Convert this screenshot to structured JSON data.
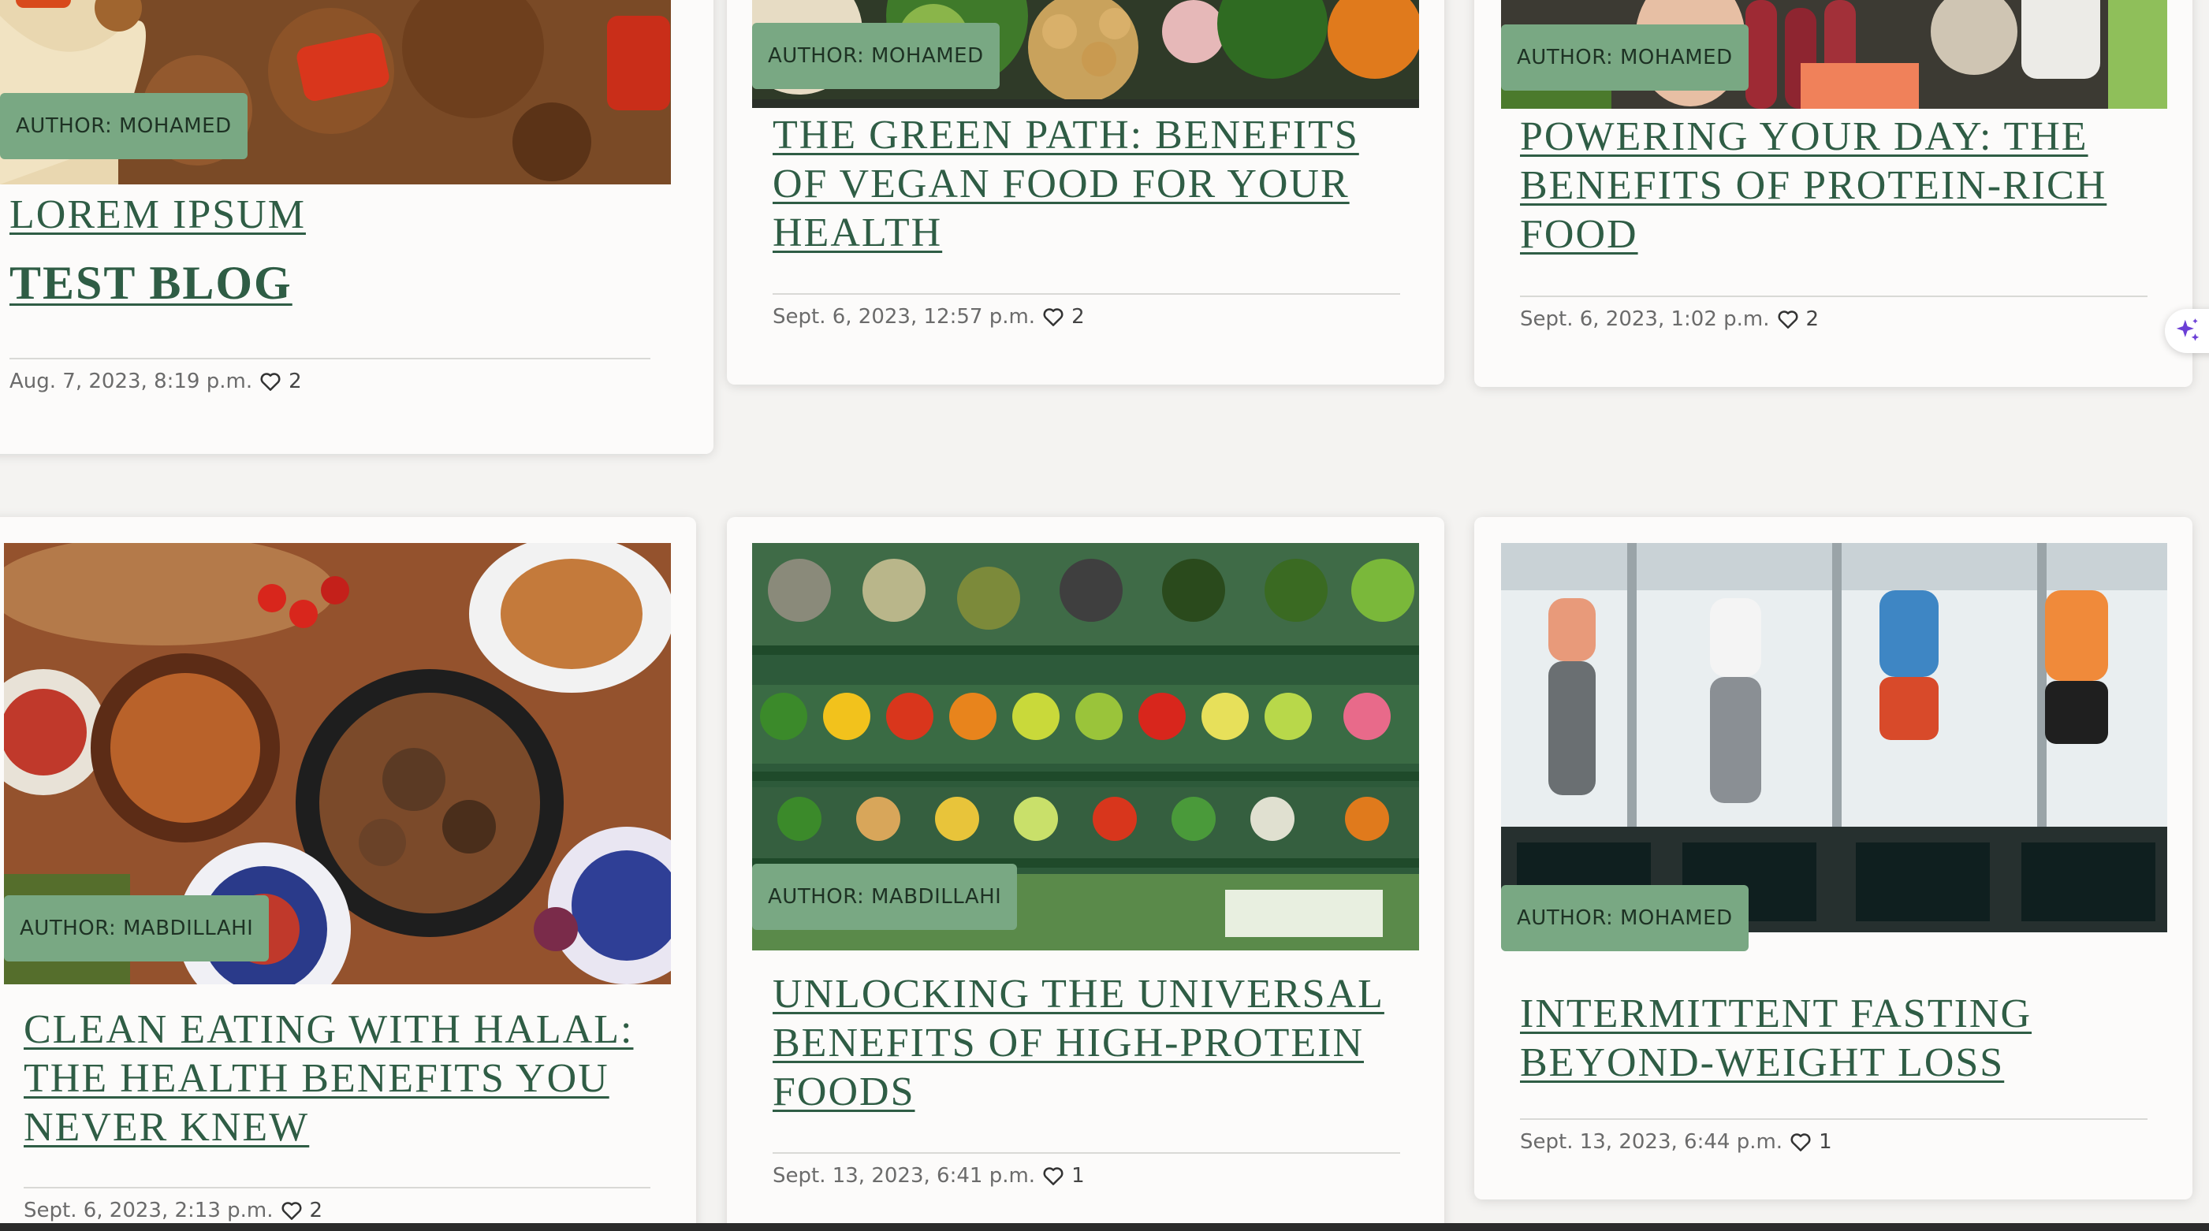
{
  "posts": [
    {
      "author": "AUTHOR: MOHAMED",
      "title_line1": "LOREM IPSUM",
      "title_line2": "TEST BLOG",
      "date": "Aug. 7, 2023, 8:19 p.m.",
      "likes": "2"
    },
    {
      "author": "AUTHOR: MOHAMED",
      "title": "THE GREEN PATH: BENEFITS OF VEGAN FOOD FOR YOUR HEALTH",
      "date": "Sept. 6, 2023, 12:57 p.m.",
      "likes": "2"
    },
    {
      "author": "AUTHOR: MOHAMED",
      "title": "POWERING YOUR DAY: THE BENEFITS OF PROTEIN-RICH FOOD",
      "date": "Sept. 6, 2023, 1:02 p.m.",
      "likes": "2"
    },
    {
      "author": "AUTHOR: MABDILLAHI",
      "title": "CLEAN EATING WITH HALAL: THE HEALTH BENEFITS YOU NEVER KNEW",
      "date": "Sept. 6, 2023, 2:13 p.m.",
      "likes": "2"
    },
    {
      "author": "AUTHOR: MABDILLAHI",
      "title": "UNLOCKING THE UNIVERSAL BENEFITS OF HIGH-PROTEIN FOODS",
      "date": "Sept. 13, 2023, 6:41 p.m.",
      "likes": "1"
    },
    {
      "author": "AUTHOR: MOHAMED",
      "title": "INTERMITTENT FASTING BEYOND-WEIGHT LOSS",
      "date": "Sept. 13, 2023, 6:44 p.m.",
      "likes": "1"
    }
  ],
  "icons": {
    "like": "heart-outline-icon",
    "assistant": "sparkle-icon"
  },
  "colors": {
    "title": "#2f5d45",
    "badge": "#79a883",
    "background": "#f4f3f1",
    "card": "#fcfbfa",
    "assistant": "#6b3fd6"
  }
}
